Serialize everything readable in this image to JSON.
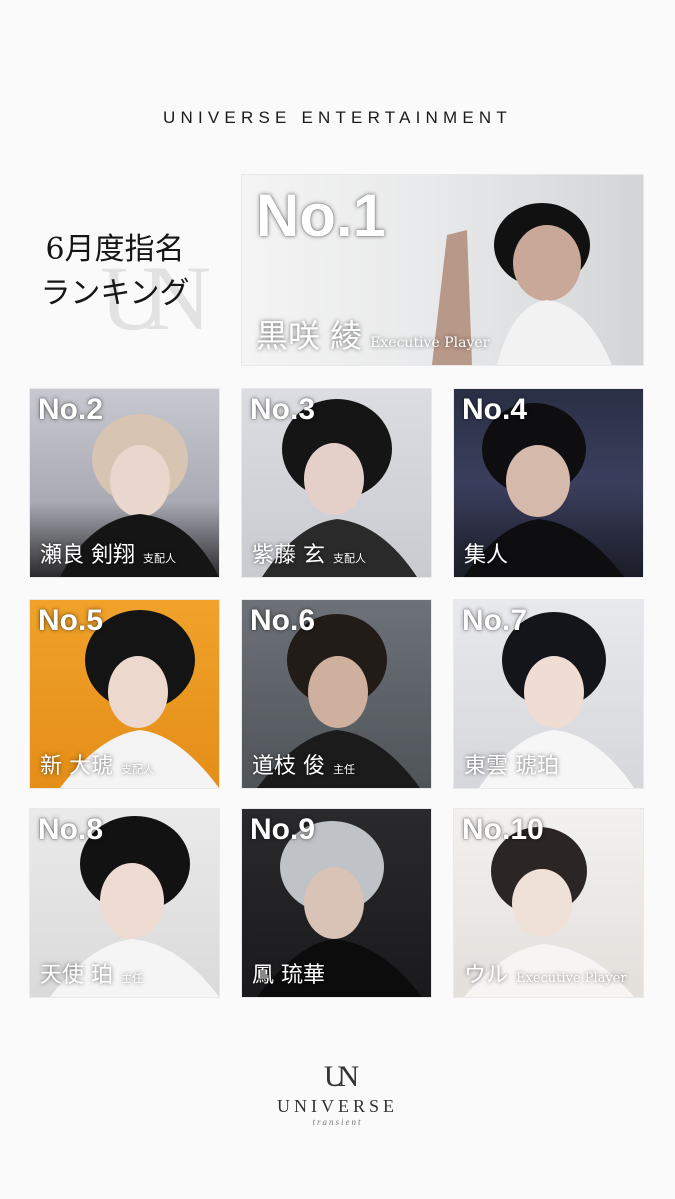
{
  "header": {
    "brand": "UNIVERSE ENTERTAINMENT"
  },
  "title": {
    "line1": "6月度指名",
    "line2": "ランキング",
    "watermark": "UN"
  },
  "ranking": [
    {
      "rank": "No.1",
      "name": "黒咲 綾",
      "position": "Executive Player"
    },
    {
      "rank": "No.2",
      "name": "瀬良 剣翔",
      "position": "支配人"
    },
    {
      "rank": "No.3",
      "name": "紫藤 玄",
      "position": "支配人"
    },
    {
      "rank": "No.4",
      "name": "集人",
      "position": ""
    },
    {
      "rank": "No.5",
      "name": "新 大琥",
      "position": "支配人"
    },
    {
      "rank": "No.6",
      "name": "道枝 俊",
      "position": "主任"
    },
    {
      "rank": "No.7",
      "name": "東雲 琥珀",
      "position": ""
    },
    {
      "rank": "No.8",
      "name": "天使 珀",
      "position": "主任"
    },
    {
      "rank": "No.9",
      "name": "鳳 琉華",
      "position": ""
    },
    {
      "rank": "No.10",
      "name": "ウル",
      "position": "Executive Player"
    }
  ],
  "footer": {
    "logo_mark": "UN",
    "brand": "UNIVERSE",
    "sub": "transient"
  }
}
